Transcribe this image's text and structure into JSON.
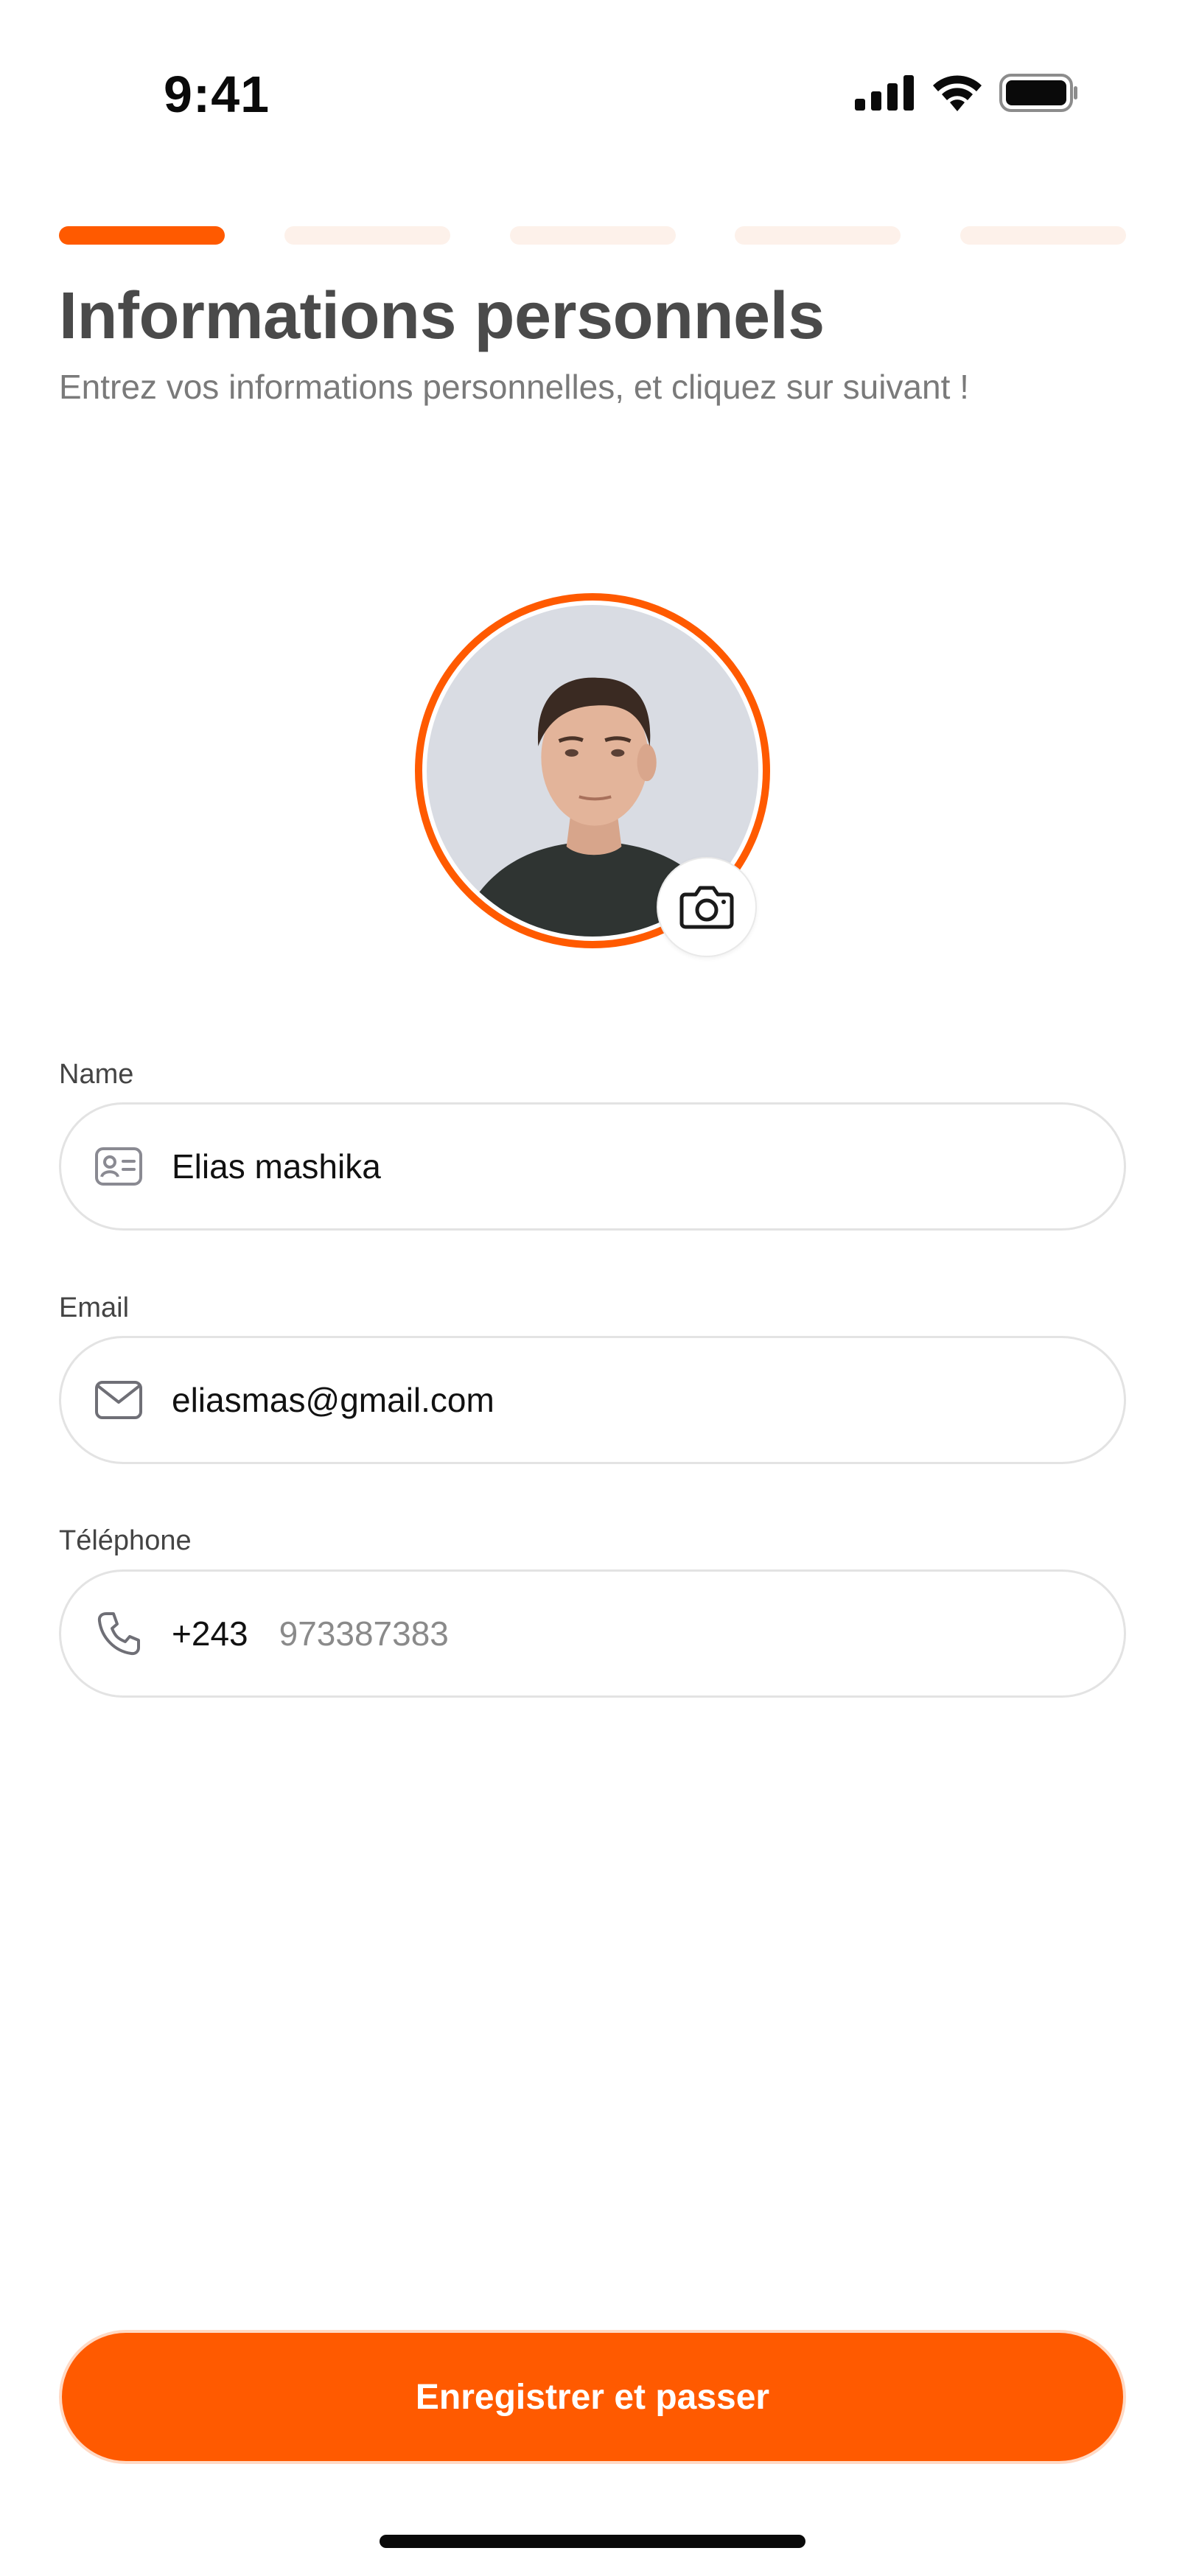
{
  "status_bar": {
    "time": "9:41"
  },
  "stepper": {
    "total_steps": 5,
    "current_step": 1
  },
  "header": {
    "title": "Informations personnels",
    "subtitle": "Entrez vos informations personnelles, et cliquez sur suivant !"
  },
  "form": {
    "name": {
      "label": "Name",
      "value": "Elias mashika"
    },
    "email": {
      "label": "Email",
      "value": "eliasmas@gmail.com"
    },
    "phone": {
      "label": "Téléphone",
      "country_code": "+243",
      "placeholder": "973387383"
    }
  },
  "actions": {
    "primary_label": "Enregistrer et passer"
  },
  "colors": {
    "accent": "#ff5a00",
    "inactive_step": "#fdf1ea"
  }
}
